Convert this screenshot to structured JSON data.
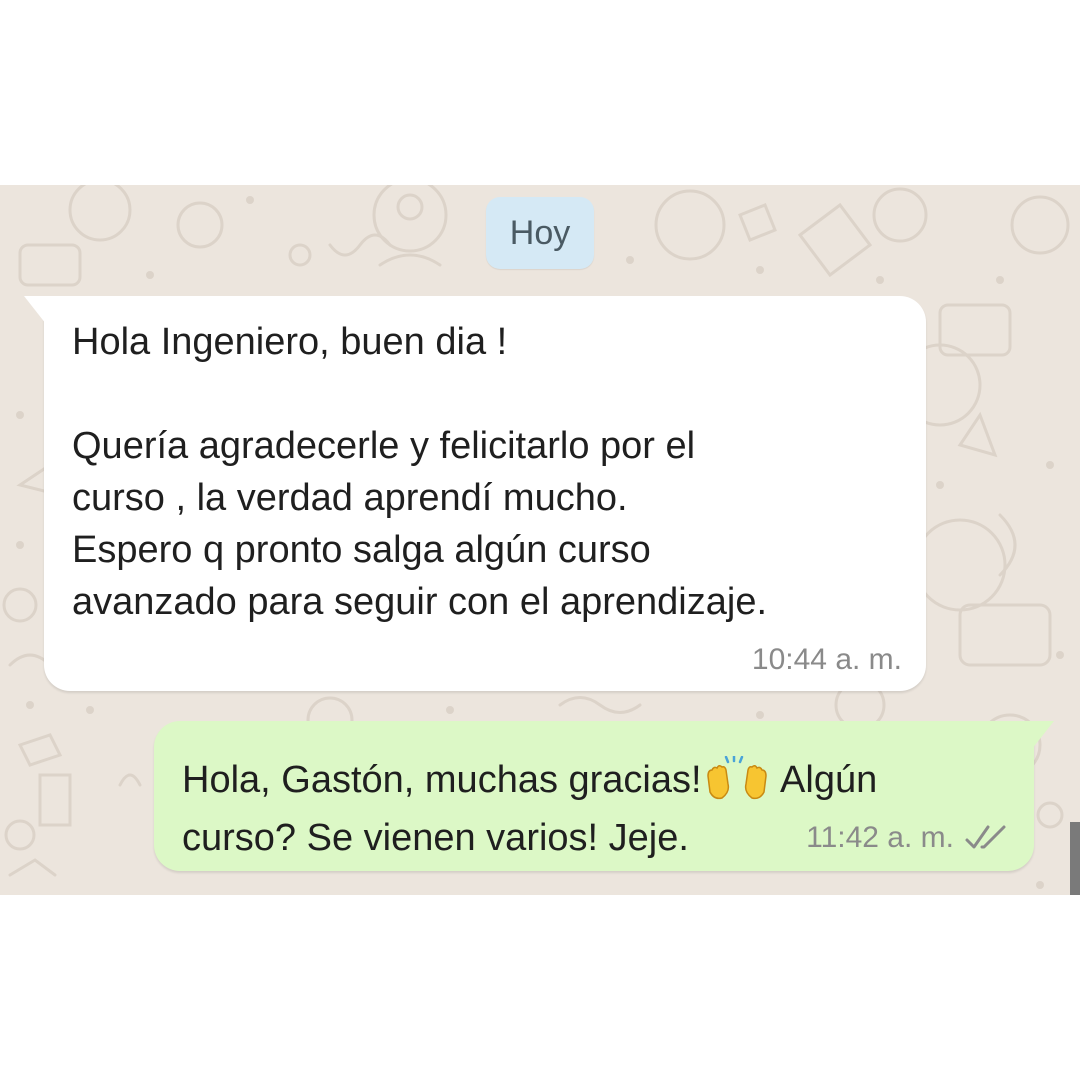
{
  "date_chip": {
    "label": "Hoy"
  },
  "messages": [
    {
      "direction": "incoming",
      "lines": [
        "Hola Ingeniero, buen dia !",
        "",
        "Quería agradecerle y felicitarlo por el",
        "curso , la verdad aprendí mucho.",
        "Espero q pronto salga algún curso",
        "avanzado para seguir con el aprendizaje."
      ],
      "time": "10:44 a. m."
    },
    {
      "direction": "outgoing",
      "line1_before_emoji": "Hola, Gastón, muchas gracias!",
      "emoji": "raising-hands-emoji",
      "line1_after_emoji": " Algún",
      "line2": "curso? Se vienen varios! Jeje.",
      "time": "11:42 a. m.",
      "status_icon": "double-check-icon"
    }
  ],
  "colors": {
    "wallpaper": "#ece5dd",
    "incoming_bubble": "#ffffff",
    "outgoing_bubble": "#dcf8c6",
    "date_chip": "#d5e9f5"
  }
}
